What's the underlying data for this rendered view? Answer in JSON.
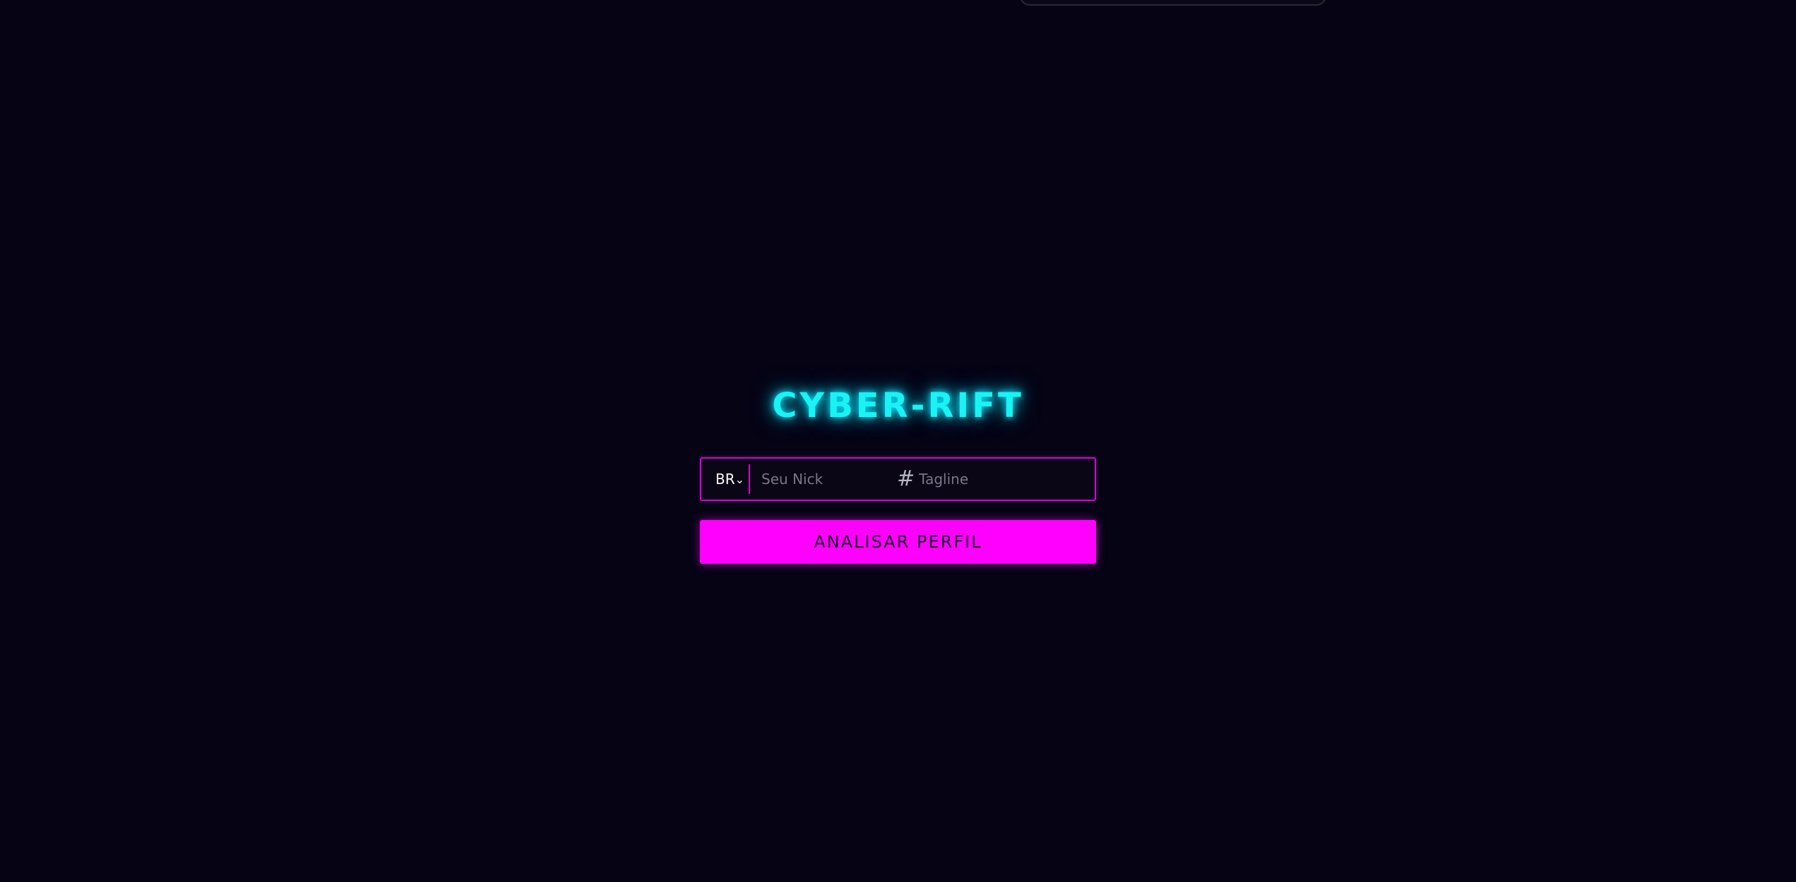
{
  "app": {
    "title": "CYBER-RIFT"
  },
  "search": {
    "region_value": "BR",
    "region_options": [
      "BR"
    ],
    "nick_placeholder": "Seu Nick",
    "hash_symbol": "#",
    "tagline_placeholder": "Tagline"
  },
  "actions": {
    "submit_label": "ANALISAR PERFIL"
  },
  "icons": {
    "dropdown": "chevron-down-icon"
  },
  "colors": {
    "background": "#050314",
    "title_glow": "#19f3f3",
    "accent": "#ff00ff",
    "border": "#d600d6"
  }
}
